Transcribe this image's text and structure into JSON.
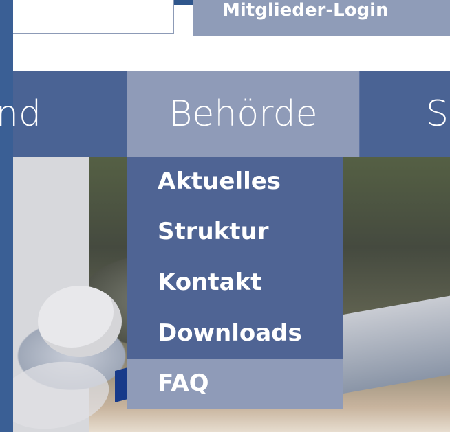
{
  "header": {
    "login_label": "Mitglieder-Login",
    "search_value": ""
  },
  "nav": {
    "items": [
      {
        "label": "nd"
      },
      {
        "label": "Behörde"
      },
      {
        "label": "S"
      }
    ]
  },
  "dropdown": {
    "items": [
      {
        "label": "Aktuelles"
      },
      {
        "label": "Struktur"
      },
      {
        "label": "Kontakt"
      },
      {
        "label": "Downloads"
      },
      {
        "label": "FAQ"
      }
    ]
  },
  "colors": {
    "nav_bg": "#4a6394",
    "active_tab": "#8f9bb8",
    "dropdown_bg": "#4f6494",
    "left_bar": "#3a5f95"
  }
}
